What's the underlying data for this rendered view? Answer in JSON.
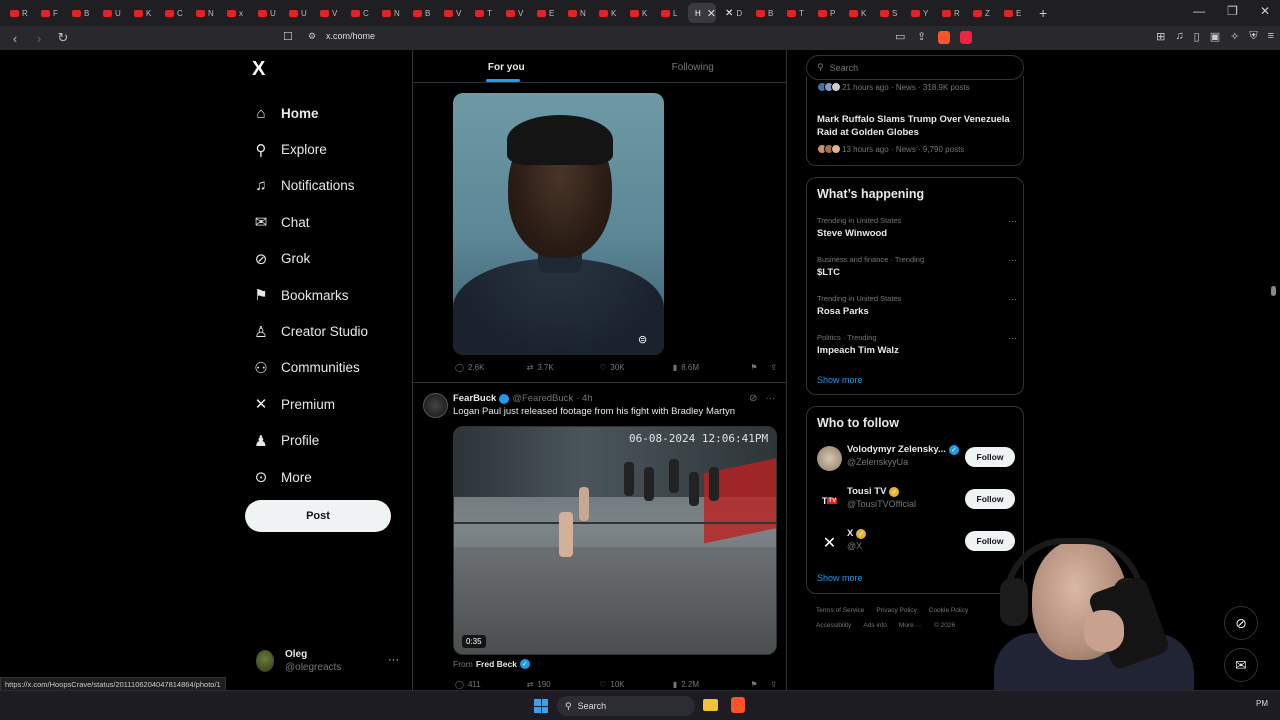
{
  "browser": {
    "tabs": [
      {
        "letter": "R"
      },
      {
        "letter": "F"
      },
      {
        "letter": "B"
      },
      {
        "letter": "U"
      },
      {
        "letter": "K"
      },
      {
        "letter": "C"
      },
      {
        "letter": "N"
      },
      {
        "letter": "x"
      },
      {
        "letter": "U"
      },
      {
        "letter": "U"
      },
      {
        "letter": "V"
      },
      {
        "letter": "C"
      },
      {
        "letter": "N"
      },
      {
        "letter": "B"
      },
      {
        "letter": "V"
      },
      {
        "letter": "T"
      },
      {
        "letter": "V"
      },
      {
        "letter": "E"
      },
      {
        "letter": "N"
      },
      {
        "letter": "K"
      },
      {
        "letter": "K"
      },
      {
        "letter": "L"
      },
      {
        "letter": "H"
      },
      {
        "letter": "D"
      },
      {
        "letter": "B"
      },
      {
        "letter": "T"
      },
      {
        "letter": "P"
      },
      {
        "letter": "K"
      },
      {
        "letter": "S"
      },
      {
        "letter": "Y"
      },
      {
        "letter": "R"
      },
      {
        "letter": "Z"
      },
      {
        "letter": "E"
      }
    ],
    "active_tab_index": 22,
    "url": "x.com/home",
    "status_url": "https://x.com/HoopsCrave/status/2011106204047814864/photo/1"
  },
  "nav": {
    "logo": "X",
    "items": [
      {
        "label": "Home",
        "icon": "home-icon",
        "glyph": "⌂"
      },
      {
        "label": "Explore",
        "icon": "search-icon",
        "glyph": "⚲"
      },
      {
        "label": "Notifications",
        "icon": "bell-icon",
        "glyph": "♫"
      },
      {
        "label": "Chat",
        "icon": "mail-icon",
        "glyph": "✉"
      },
      {
        "label": "Grok",
        "icon": "grok-icon",
        "glyph": "⊘"
      },
      {
        "label": "Bookmarks",
        "icon": "bookmark-icon",
        "glyph": "⚑"
      },
      {
        "label": "Creator Studio",
        "icon": "creator-icon",
        "glyph": "♙"
      },
      {
        "label": "Communities",
        "icon": "communities-icon",
        "glyph": "⚇"
      },
      {
        "label": "Premium",
        "icon": "x-premium-icon",
        "glyph": "✕"
      },
      {
        "label": "Profile",
        "icon": "person-icon",
        "glyph": "♟"
      },
      {
        "label": "More",
        "icon": "more-circle-icon",
        "glyph": "⊙"
      }
    ],
    "post_label": "Post",
    "account": {
      "name": "Oleg",
      "handle": "@olegreacts"
    }
  },
  "feed": {
    "tabs": [
      {
        "label": "For you"
      },
      {
        "label": "Following"
      }
    ],
    "tweet1": {
      "replies": "2.6K",
      "reposts": "3.7K",
      "likes": "30K",
      "views": "8.6M"
    },
    "tweet2": {
      "name": "FearBuck",
      "handle": "@FearedBuck",
      "time": "· 4h",
      "text": "Logan Paul just released footage from his fight with Bradley Martyn",
      "video_timestamp": "06-08-2024 12:06:41PM",
      "duration": "0:35",
      "from_label": "From",
      "from_name": "Fred Beck",
      "replies": "411",
      "reposts": "190",
      "likes": "10K",
      "views": "2.2M"
    }
  },
  "right": {
    "search_placeholder": "Search",
    "news": [
      {
        "meta": "21 hours ago · News · 318.9K posts"
      },
      {
        "title": "Mark Ruffalo Slams Trump Over Venezuela Raid at Golden Globes",
        "meta": "13 hours ago · News · 9,790 posts"
      }
    ],
    "happening_title": "What’s happening",
    "trends": [
      {
        "meta": "Trending in United States",
        "name": "Steve Winwood"
      },
      {
        "meta": "Business and finance · Trending",
        "name": "$LTC"
      },
      {
        "meta": "Trending in United States",
        "name": "Rosa Parks"
      },
      {
        "meta": "Politics · Trending",
        "name": "Impeach Tim Walz"
      }
    ],
    "show_more": "Show more",
    "wtf_title": "Who to follow",
    "who_to_follow": [
      {
        "name": "Volodymyr Zelensky...",
        "handle": "@ZelenskyyUa",
        "badge": "blue"
      },
      {
        "name": "Tousi TV",
        "handle": "@TousiTVOfficial",
        "badge": "gold"
      },
      {
        "name": "X",
        "handle": "@X",
        "badge": "gold"
      }
    ],
    "follow_label": "Follow",
    "footer_row1": [
      "Terms of Service",
      "Privacy Policy",
      "Cookie Policy"
    ],
    "footer_row2": [
      "Accessibility",
      "Ads info",
      "More ···",
      "© 2026"
    ]
  },
  "taskbar": {
    "search_label": "Search",
    "tray_text": "PM"
  },
  "colors": {
    "accent": "#1d9bf0",
    "background": "#000000",
    "border": "#2f3336",
    "muted": "#71767b"
  }
}
